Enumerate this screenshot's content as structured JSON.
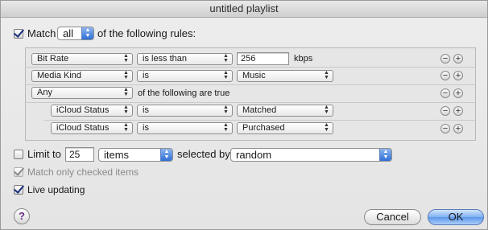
{
  "window": {
    "title": "untitled playlist"
  },
  "match": {
    "checked": true,
    "label_prefix": "Match",
    "quantifier": "all",
    "label_suffix": "of the following rules:"
  },
  "rules": [
    {
      "field": "Bit Rate",
      "operator": "is less than",
      "value": "256",
      "unit": "kbps"
    },
    {
      "field": "Media Kind",
      "operator": "is",
      "value": "Music"
    },
    {
      "field": "Any",
      "text": "of the following are true"
    },
    {
      "field": "iCloud Status",
      "operator": "is",
      "value": "Matched"
    },
    {
      "field": "iCloud Status",
      "operator": "is",
      "value": "Purchased"
    }
  ],
  "rule_controls": {
    "remove": "−",
    "add": "+"
  },
  "limit": {
    "checked": false,
    "label": "Limit to",
    "count": "25",
    "unit": "items",
    "selected_by_label": "selected by",
    "selected_by": "random"
  },
  "match_only_checked": {
    "checked": true,
    "enabled": false,
    "label": "Match only checked items"
  },
  "live_updating": {
    "checked": true,
    "label": "Live updating"
  },
  "buttons": {
    "help": "?",
    "cancel": "Cancel",
    "ok": "OK"
  },
  "colors": {
    "accent": "#2f6fd6",
    "check": "#1b2e7a"
  }
}
